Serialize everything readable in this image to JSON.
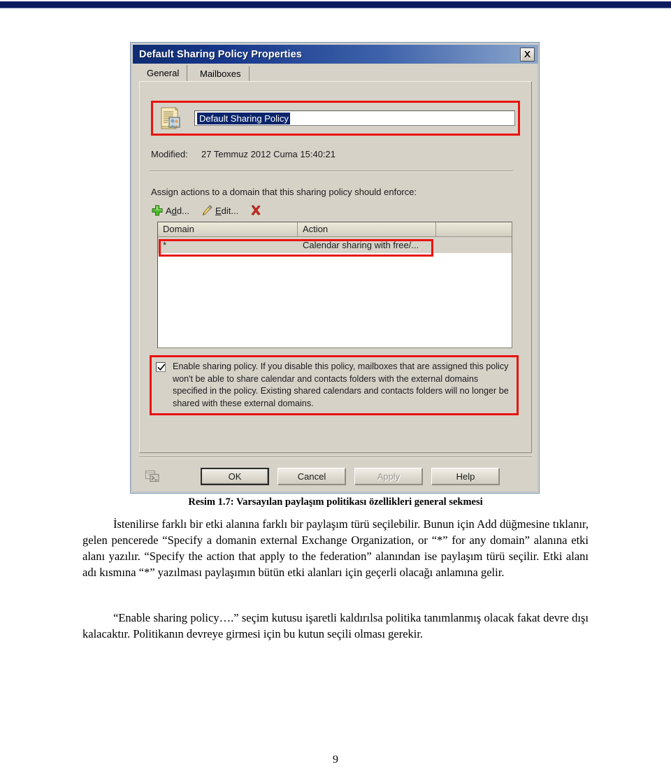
{
  "document": {
    "page_number": "9",
    "caption": "Resim 1.7: Varsayılan paylaşım politikası özellikleri general sekmesi",
    "paragraph_1": "İstenilirse farklı bir etki alanına farklı bir paylaşım türü seçilebilir. Bunun için Add düğmesine tıklanır, gelen pencerede “Specify a domanin external Exchange Organization, or “*” for any domain” alanına etki alanı yazılır. “Specify the action that apply to the federation” alanından ise paylaşım türü seçilir. Etki alanı adı kısmına “*” yazılması paylaşımın bütün etki alanları için geçerli olacağı anlamına gelir.",
    "paragraph_2": "“Enable sharing policy….” seçim kutusu işaretli kaldırılsa politika tanımlanmış olacak fakat devre dışı kalacaktır. Politikanın devreye girmesi için bu kutun seçili olması gerekir."
  },
  "dialog": {
    "title": "Default Sharing Policy Properties",
    "close_label": "×",
    "tabs": [
      {
        "label": "General",
        "active": true
      },
      {
        "label": "Mailboxes",
        "active": false
      }
    ],
    "name_field": {
      "value": "Default Sharing Policy",
      "icon": "sharing-policy-icon"
    },
    "modified": {
      "label": "Modified:",
      "value": "27 Temmuz 2012 Cuma 15:40:21"
    },
    "assign_label": "Assign actions to a domain that this sharing policy should enforce:",
    "commands": [
      {
        "label": "Add...",
        "icon": "plus-icon"
      },
      {
        "label": "Edit...",
        "icon": "pencil-icon"
      },
      {
        "label": "",
        "icon": "delete-x-icon"
      }
    ],
    "list": {
      "columns": [
        "Domain",
        "Action",
        ""
      ],
      "rows": [
        {
          "domain": "*",
          "action": "Calendar sharing with free/...",
          "extra": ""
        }
      ]
    },
    "enable_checkbox": {
      "checked": true,
      "text": "Enable sharing policy. If you disable this policy, mailboxes that are assigned this policy won't be able to share calendar and contacts folders with the external domains specified in the policy. Existing shared calendars and contacts folders will no longer be shared with these external domains."
    },
    "footer": {
      "help_icon": "powershell-command-icon",
      "buttons": [
        {
          "label": "OK",
          "state": "default"
        },
        {
          "label": "Cancel",
          "state": "normal"
        },
        {
          "label": "Apply",
          "state": "disabled"
        },
        {
          "label": "Help",
          "state": "normal"
        }
      ]
    }
  },
  "annotations": {
    "highlight_color": "#e8140e",
    "boxes": [
      "name-field-highlight",
      "list-row-highlight",
      "enable-policy-highlight"
    ]
  },
  "colors": {
    "top_rule": "#0b1a5e",
    "dialog_face": "#d6d2c8",
    "titlebar_start": "#0f2d73",
    "titlebar_end": "#8ba6cc",
    "selection_blue": "#0a246a"
  }
}
